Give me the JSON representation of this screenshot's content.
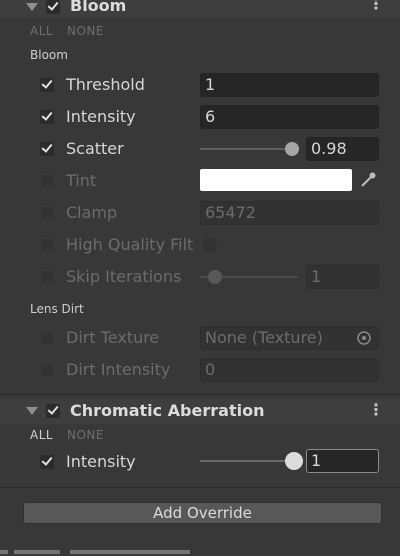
{
  "bloom": {
    "title": "Bloom",
    "all": "ALL",
    "none": "NONE",
    "group": "Bloom",
    "threshold": {
      "label": "Threshold",
      "value": "1"
    },
    "intensity": {
      "label": "Intensity",
      "value": "6"
    },
    "scatter": {
      "label": "Scatter",
      "value": "0.98",
      "level": 0.98
    },
    "tint": {
      "label": "Tint",
      "color": "#ffffff"
    },
    "clamp": {
      "label": "Clamp",
      "value": "65472"
    },
    "high_quality": {
      "label": "High Quality Filt"
    },
    "skip_iterations": {
      "label": "Skip Iterations",
      "value": "1",
      "level": 0.1
    },
    "lens_dirt_group": "Lens Dirt",
    "dirt_texture": {
      "label": "Dirt Texture",
      "value": "None (Texture)"
    },
    "dirt_intensity": {
      "label": "Dirt Intensity",
      "value": "0"
    }
  },
  "chromatic": {
    "title": "Chromatic Aberration",
    "all": "ALL",
    "none": "NONE",
    "intensity": {
      "label": "Intensity",
      "value": "1",
      "level": 1.0
    }
  },
  "add_override_label": "Add Override",
  "colors": {
    "background": "#383838",
    "field": "#262626",
    "disabled_text": "#6c6c6c"
  }
}
